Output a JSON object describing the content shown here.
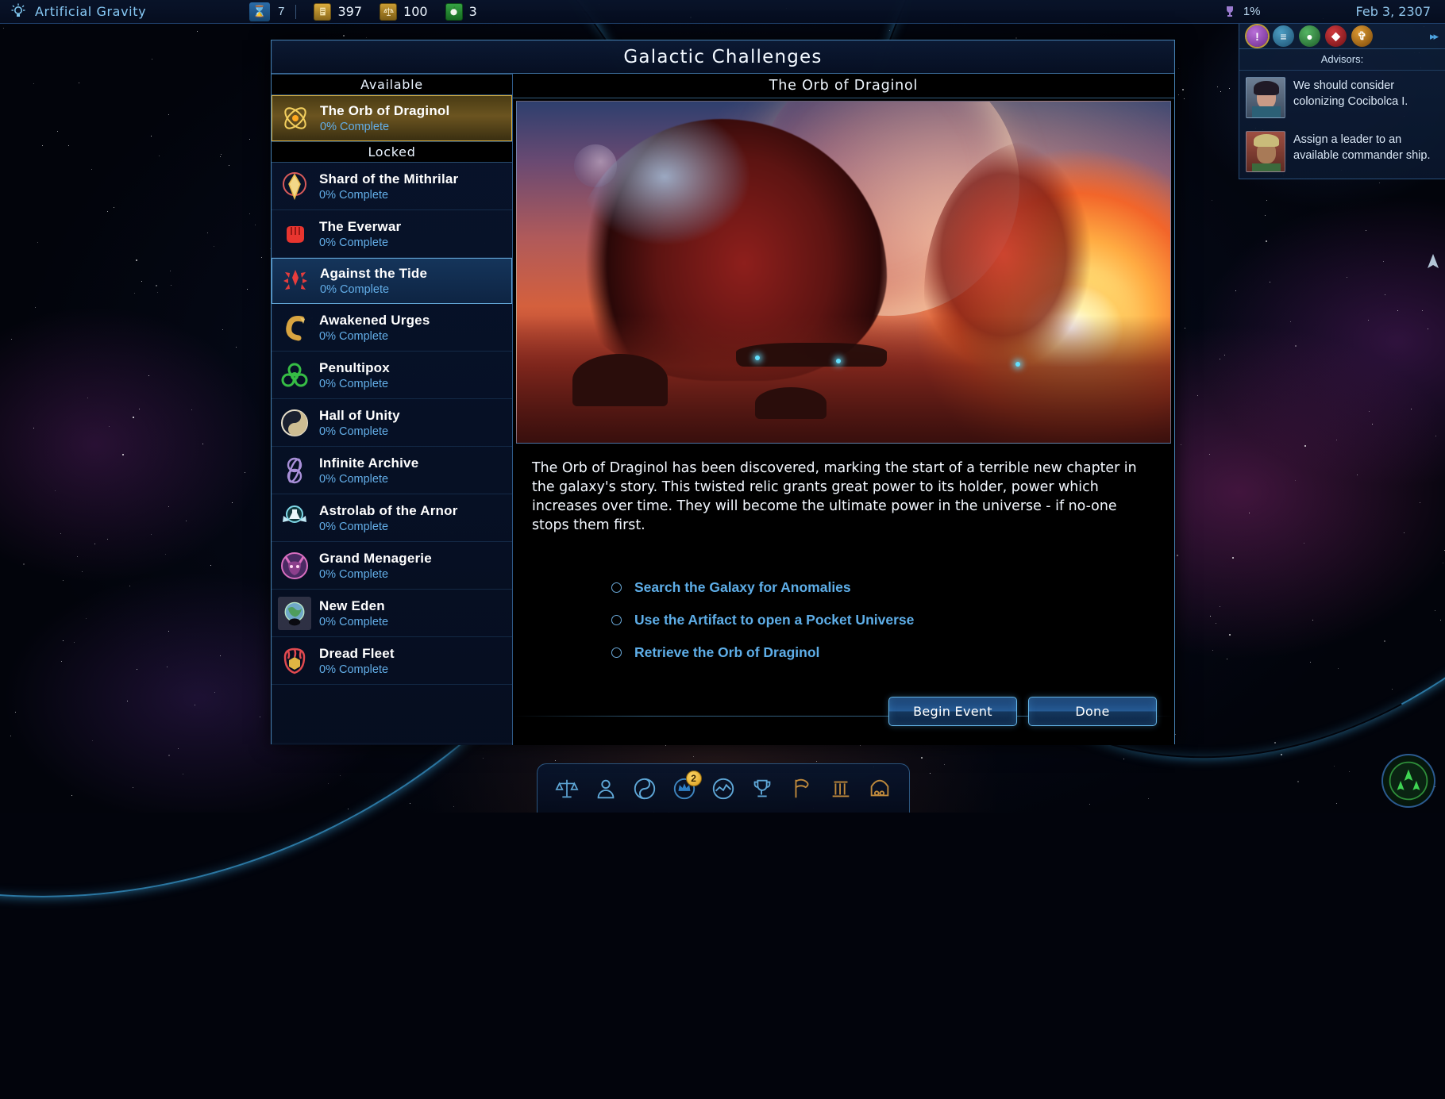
{
  "topbar": {
    "tech_icon": "lightbulb-icon",
    "tech_name": "Artificial Gravity",
    "turns_icon": "hourglass-icon",
    "turns_value": "7",
    "resources": [
      {
        "icon": "research-scroll-icon",
        "value": "397",
        "color": "#c79a33"
      },
      {
        "icon": "scales-icon",
        "value": "100",
        "color": "#b98f2e"
      },
      {
        "icon": "food-apple-icon",
        "value": "3",
        "color": "#2f8c3a"
      }
    ],
    "trophy_icon": "trophy-icon",
    "trophy_value": "1%",
    "date": "Feb 3, 2307"
  },
  "advisor_panel": {
    "title": "Advisors:",
    "icons": [
      {
        "name": "alert-icon",
        "glyph": "!",
        "color": "#8e3fb0",
        "selected": true
      },
      {
        "name": "reports-icon",
        "glyph": "≡",
        "color": "#2c6e93",
        "selected": false
      },
      {
        "name": "planets-icon",
        "glyph": "●",
        "color": "#2f7a3c",
        "selected": false
      },
      {
        "name": "military-icon",
        "glyph": "◆",
        "color": "#9e1f25",
        "selected": false
      },
      {
        "name": "diplomacy-icon",
        "glyph": "✠",
        "color": "#b06a18",
        "selected": false
      }
    ],
    "next_icon": "double-chevron-right-icon",
    "messages": [
      {
        "avatar": "female-advisor-avatar",
        "text": "We should consider colonizing Cocibolca I."
      },
      {
        "avatar": "male-advisor-avatar",
        "text": "Assign a leader to an available commander ship."
      }
    ]
  },
  "dialog": {
    "title": "Galactic Challenges",
    "groups": [
      {
        "label": "Available",
        "items": [
          {
            "name": "The Orb of Draginol",
            "progress": "0% Complete",
            "icon": "atom-orb-icon",
            "state": "active",
            "color": "#e0b443"
          }
        ]
      },
      {
        "label": "Locked",
        "items": [
          {
            "name": "Shard of the Mithrilar",
            "progress": "0% Complete",
            "icon": "crystal-shard-icon",
            "state": "normal",
            "color": "#d96a6a"
          },
          {
            "name": "The Everwar",
            "progress": "0% Complete",
            "icon": "fist-icon",
            "state": "normal",
            "color": "#e03c3c"
          },
          {
            "name": "Against the Tide",
            "progress": "0% Complete",
            "icon": "starburst-arrows-icon",
            "state": "hover",
            "color": "#e04646"
          },
          {
            "name": "Awakened Urges",
            "progress": "0% Complete",
            "icon": "serpent-icon",
            "state": "normal",
            "color": "#d9a94a"
          },
          {
            "name": "Penultipox",
            "progress": "0% Complete",
            "icon": "biohazard-icon",
            "state": "normal",
            "color": "#3fbf4a"
          },
          {
            "name": "Hall of Unity",
            "progress": "0% Complete",
            "icon": "yin-yang-icon",
            "state": "normal",
            "color": "#d8cfbe"
          },
          {
            "name": "Infinite Archive",
            "progress": "0% Complete",
            "icon": "infinity-loop-icon",
            "state": "normal",
            "color": "#9b7fd4"
          },
          {
            "name": "Astrolab of the Arnor",
            "progress": "0% Complete",
            "icon": "flask-wings-icon",
            "state": "normal",
            "color": "#7fd8e8"
          },
          {
            "name": "Grand Menagerie",
            "progress": "0% Complete",
            "icon": "beast-head-icon",
            "state": "normal",
            "color": "#c861b8"
          },
          {
            "name": "New Eden",
            "progress": "0% Complete",
            "icon": "planet-eden-icon",
            "state": "selected-dim",
            "color": "#5fc07a"
          },
          {
            "name": "Dread Fleet",
            "progress": "0% Complete",
            "icon": "dread-crest-icon",
            "state": "normal",
            "color": "#d84a52"
          }
        ]
      }
    ],
    "detail": {
      "title": "The Orb of Draginol",
      "art_name": "orb-of-draginol-artwork",
      "description": "The Orb of Draginol has been discovered, marking the start of a terrible new chapter in the galaxy's story. This twisted relic grants great power to its holder, power which increases over time. They will become the ultimate power in the universe - if no-one stops them first.",
      "objectives": [
        "Search the Galaxy for Anomalies",
        "Use the Artifact to open a Pocket Universe",
        "Retrieve the Orb of Draginol"
      ]
    },
    "buttons": {
      "begin_event": "Begin Event",
      "done": "Done"
    }
  },
  "taskbar": {
    "items": [
      {
        "name": "government-scales-icon",
        "badge": null
      },
      {
        "name": "population-person-icon",
        "badge": null
      },
      {
        "name": "yin-yang-culture-icon",
        "badge": null
      },
      {
        "name": "crown-leaders-icon",
        "badge": "2"
      },
      {
        "name": "economy-graph-icon",
        "badge": null
      },
      {
        "name": "victory-trophy-icon",
        "badge": null
      },
      {
        "name": "factions-flag-icon",
        "badge": null
      },
      {
        "name": "senate-columns-icon",
        "badge": null
      },
      {
        "name": "circus-tent-icon",
        "badge": null
      }
    ],
    "minimap_name": "fleet-radar-minimap"
  }
}
